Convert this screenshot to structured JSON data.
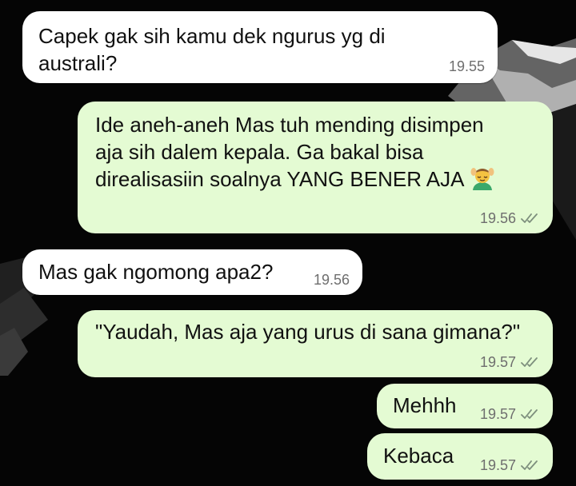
{
  "chat": {
    "messages": [
      {
        "direction": "incoming",
        "lines": [
          "Capek gak sih kamu dek ngurus yg di",
          "australi?"
        ],
        "time": "19.55"
      },
      {
        "direction": "outgoing",
        "lines": [
          "Ide aneh-aneh Mas tuh mending disimpen",
          "aja sih dalem kepala. Ga bakal bisa",
          "direalisasiin soalnya YANG BENER AJA"
        ],
        "emoji": "face-massage-emoji",
        "time": "19.56",
        "status_icon": "double-check-icon"
      },
      {
        "direction": "incoming",
        "lines": [
          "Mas gak ngomong apa2?"
        ],
        "time": "19.56"
      },
      {
        "direction": "outgoing",
        "lines": [
          "\"Yaudah, Mas aja yang urus di sana gimana?\""
        ],
        "time": "19.57",
        "status_icon": "double-check-icon"
      },
      {
        "direction": "outgoing",
        "lines": [
          "Mehhh"
        ],
        "time": "19.57",
        "status_icon": "double-check-icon"
      },
      {
        "direction": "outgoing",
        "lines": [
          "Kebaca"
        ],
        "time": "19.57",
        "status_icon": "double-check-icon"
      }
    ]
  },
  "colors": {
    "incoming_bubble": "#ffffff",
    "outgoing_bubble": "#e4fbd3",
    "background": "#050505",
    "timestamp": "#6e6e6e",
    "read_ticks": "#7d8f7d"
  }
}
